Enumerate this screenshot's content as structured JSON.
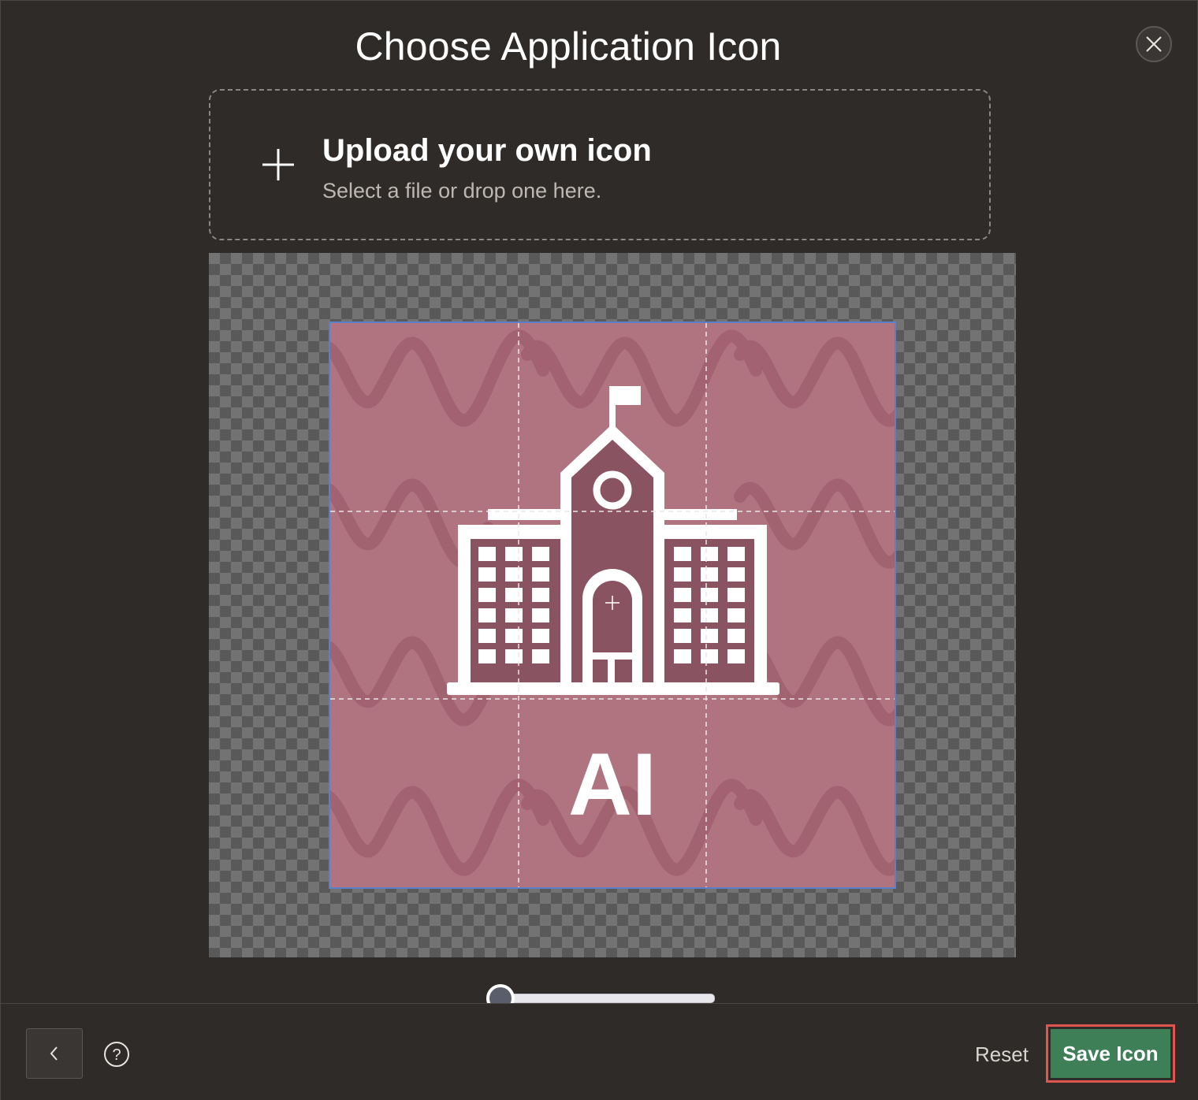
{
  "dialog": {
    "title": "Choose Application Icon",
    "close_icon": "close-icon"
  },
  "upload": {
    "heading": "Upload your own icon",
    "subtext": "Select a file or drop one here.",
    "icon": "plus-icon"
  },
  "preview": {
    "icon_text": "AI",
    "background_color": "#b07480",
    "pattern_color": "#a0606f",
    "glyph": "school-building-icon"
  },
  "zoom_slider": {
    "value": 0
  },
  "footer": {
    "back_icon": "chevron-left-icon",
    "help_icon": "help-icon",
    "reset_label": "Reset",
    "save_label": "Save Icon"
  },
  "colors": {
    "background": "#2f2b28",
    "save_button": "#3f7f58",
    "highlight_border": "#e0564e",
    "crop_border": "#5b7fc9"
  }
}
